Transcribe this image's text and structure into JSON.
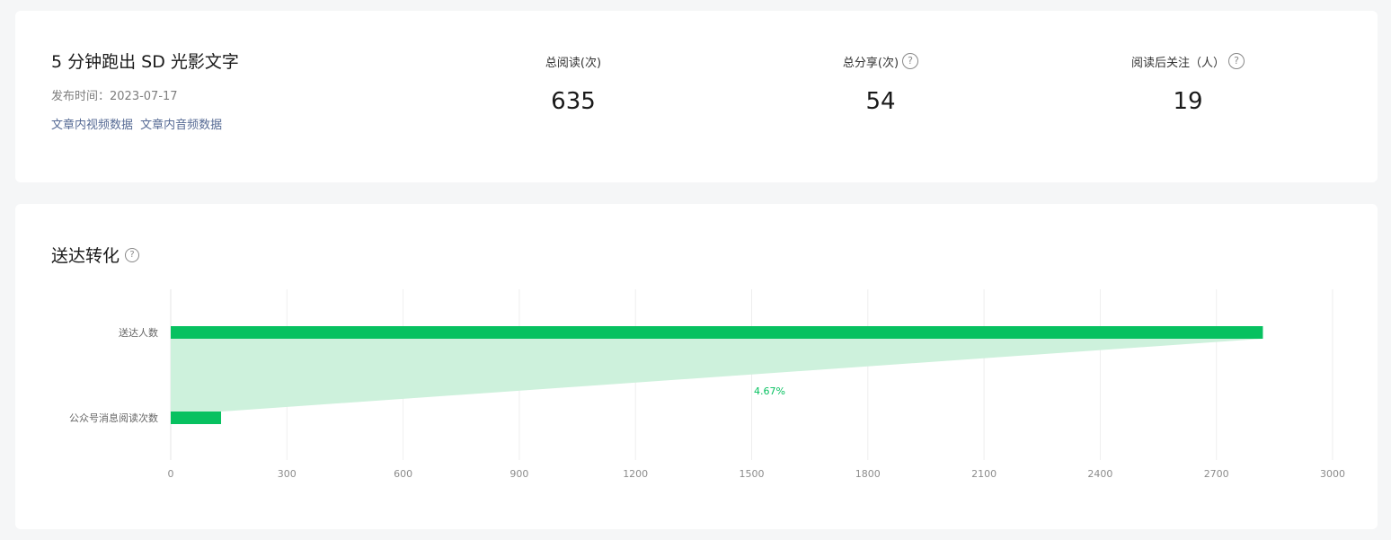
{
  "article": {
    "title": "5 分钟跑出 SD 光影文字",
    "publish_time": "发布时间：2023-07-17",
    "links": [
      "文章内视频数据",
      "文章内音频数据"
    ]
  },
  "stats": [
    {
      "label": "总阅读(次)",
      "value": "635",
      "has_help": false
    },
    {
      "label": "总分享(次)",
      "value": "54",
      "has_help": true
    },
    {
      "label": "阅读后关注（人）",
      "value": "19",
      "has_help": true
    }
  ],
  "help_icon": "question-circle-icon",
  "funnel": {
    "title": "送达转化"
  },
  "colors": {
    "bar": "#07c160",
    "area": "#cdf1dc",
    "link": "#576b95"
  },
  "chart_data": {
    "type": "bar",
    "orientation": "horizontal",
    "categories": [
      "送达人数",
      "公众号消息阅读次数"
    ],
    "values": [
      2820,
      130
    ],
    "conversion_label": "4.67%",
    "xlim": [
      0,
      3000
    ],
    "xticks": [
      0,
      300,
      600,
      900,
      1200,
      1500,
      1800,
      2100,
      2400,
      2700,
      3000
    ],
    "grid": true
  }
}
